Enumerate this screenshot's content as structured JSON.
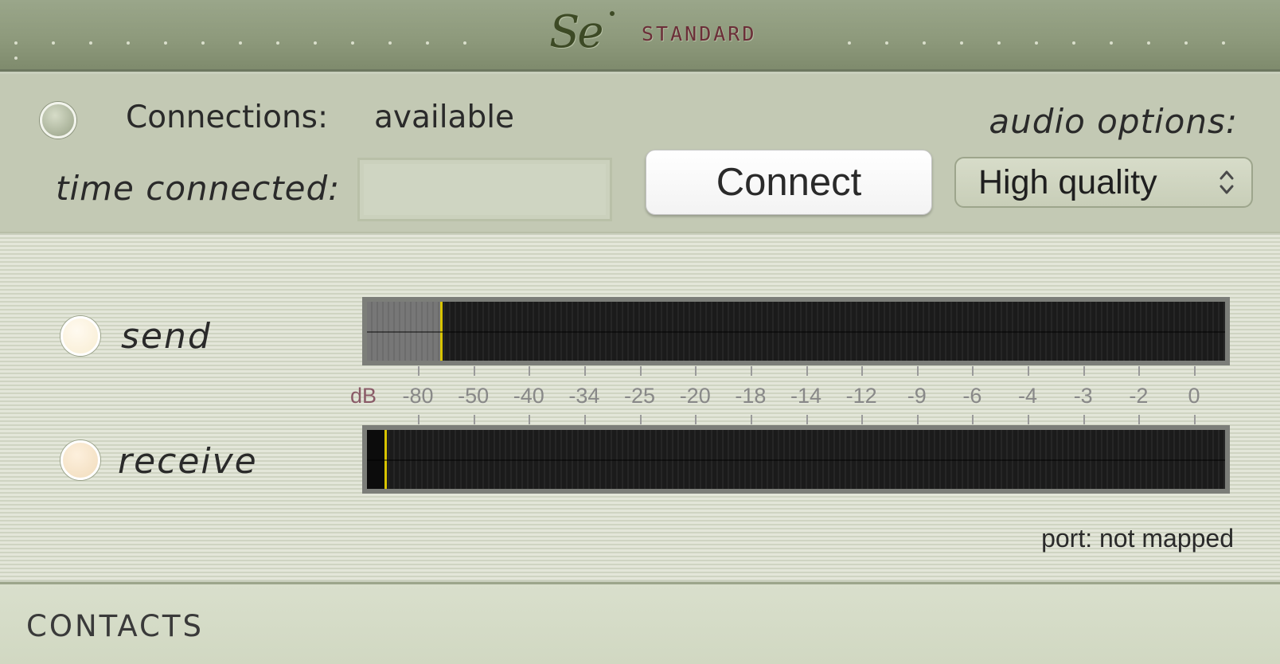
{
  "title_bar": {
    "logo_mark": "Se",
    "logo_word": "STANDARD"
  },
  "connection": {
    "label": "Connections:",
    "status": "available",
    "time_label": "time connected:",
    "time_value": "",
    "connect_label": "Connect"
  },
  "audio": {
    "label": "audio options:",
    "selected": "High quality"
  },
  "meters": {
    "send": {
      "label": "send",
      "level": 0.085
    },
    "receive": {
      "label": "receive",
      "level": 0.02
    },
    "unit": "dB",
    "scale": [
      "-80",
      "-50",
      "-40",
      "-34",
      "-25",
      "-20",
      "-18",
      "-14",
      "-12",
      "-9",
      "-6",
      "-4",
      "-3",
      "-2",
      "0"
    ]
  },
  "port_status": "port: not mapped",
  "contacts": {
    "label": "CONTACTS"
  },
  "colors": {
    "title_bar": "#8e9a7c",
    "logo_word": "#6b2e38",
    "peak": "#d8c400"
  }
}
